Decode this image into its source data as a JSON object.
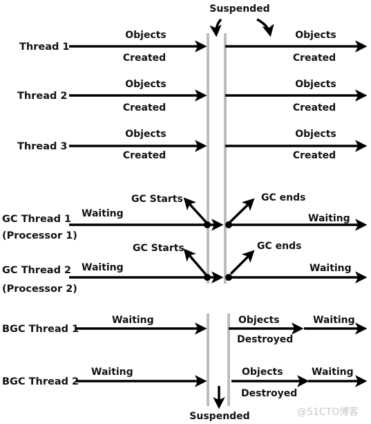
{
  "suspended_top": "Suspended",
  "suspended_bottom": "Suspended",
  "threads": [
    {
      "label": "Thread 1",
      "left_top": "Objects",
      "left_bottom": "Created",
      "right_top": "Objects",
      "right_bottom": "Created"
    },
    {
      "label": "Thread 2",
      "left_top": "Objects",
      "left_bottom": "Created",
      "right_top": "Objects",
      "right_bottom": "Created"
    },
    {
      "label": "Thread 3",
      "left_top": "Objects",
      "left_bottom": "Created",
      "right_top": "Objects",
      "right_bottom": "Created"
    }
  ],
  "gc_threads": [
    {
      "label": "GC Thread 1",
      "sublabel": "(Processor 1)",
      "left": "Waiting",
      "right": "Waiting",
      "start": "GC Starts",
      "end": "GC ends"
    },
    {
      "label": "GC Thread 2",
      "sublabel": "(Processor 2)",
      "left": "Waiting",
      "right": "Waiting",
      "start": "GC Starts",
      "end": "GC ends"
    }
  ],
  "bgc_threads": [
    {
      "label": "BGC Thread 1",
      "left": "Waiting",
      "mid_top": "Objects",
      "mid_bottom": "Destroyed",
      "right": "Waiting"
    },
    {
      "label": "BGC Thread 2",
      "left": "Waiting",
      "mid_top": "Objects",
      "mid_bottom": "Destroyed",
      "right": "Waiting"
    }
  ],
  "watermark": "@51CTO博客"
}
